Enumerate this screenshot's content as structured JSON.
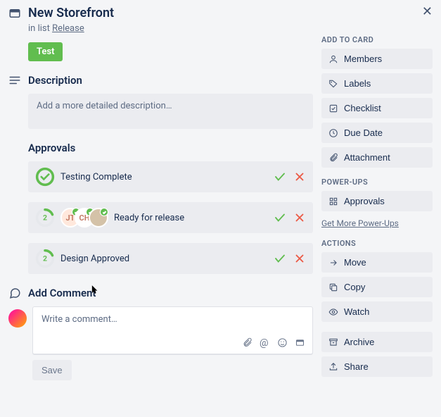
{
  "header": {
    "title": "New Storefront",
    "list_prefix": "in list ",
    "list_name": "Release"
  },
  "label_chip": "Test",
  "description": {
    "heading": "Description",
    "placeholder": "Add a more detailed description…"
  },
  "approvals": {
    "heading": "Approvals",
    "items": [
      {
        "name": "Testing Complete",
        "status": "complete"
      },
      {
        "name": "Ready for release",
        "status": "pending",
        "count": 2,
        "avatars": [
          {
            "initials": "JT",
            "bg": "#ffe8dc",
            "fg": "#c0735e"
          },
          {
            "initials": "CH",
            "bg": "#fff",
            "fg": "#c0735e"
          },
          {
            "initials": "",
            "bg": "#d4c2a8",
            "fg": "#333",
            "image": true
          }
        ]
      },
      {
        "name": "Design Approved",
        "status": "pending",
        "count": 2
      }
    ]
  },
  "comment": {
    "heading": "Add Comment",
    "placeholder": "Write a comment…",
    "save_label": "Save"
  },
  "sidebar": {
    "groups": [
      {
        "heading": "Add to card",
        "items": [
          {
            "icon": "user",
            "label": "Members"
          },
          {
            "icon": "tag",
            "label": "Labels"
          },
          {
            "icon": "check-square",
            "label": "Checklist"
          },
          {
            "icon": "clock",
            "label": "Due Date"
          },
          {
            "icon": "paperclip",
            "label": "Attachment"
          }
        ]
      },
      {
        "heading": "Power-Ups",
        "items": [
          {
            "icon": "grid",
            "label": "Approvals"
          }
        ],
        "link": "Get More Power-Ups"
      },
      {
        "heading": "Actions",
        "items": [
          {
            "icon": "arrow-right",
            "label": "Move"
          },
          {
            "icon": "copy",
            "label": "Copy"
          },
          {
            "icon": "eye",
            "label": "Watch"
          }
        ]
      },
      {
        "heading": "",
        "items": [
          {
            "icon": "archive",
            "label": "Archive"
          },
          {
            "icon": "share",
            "label": "Share"
          }
        ]
      }
    ]
  }
}
